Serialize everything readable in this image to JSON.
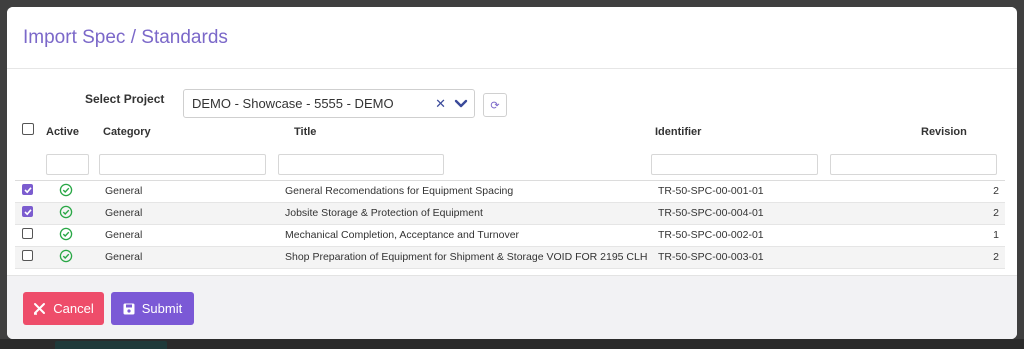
{
  "dialog": {
    "title": "Import Spec / Standards"
  },
  "project": {
    "label": "Select Project",
    "selected": "DEMO - Showcase - 5555 - DEMO",
    "clear_glyph": "✕",
    "refresh_glyph": "⟳"
  },
  "table": {
    "headers": {
      "active": "Active",
      "category": "Category",
      "title": "Title",
      "identifier": "Identifier",
      "revision": "Revision"
    },
    "rows": [
      {
        "checked": true,
        "active": true,
        "category": "General",
        "title": "General Recomendations for Equipment Spacing",
        "identifier": "TR-50-SPC-00-001-01",
        "revision": "2"
      },
      {
        "checked": true,
        "active": true,
        "category": "General",
        "title": "Jobsite Storage & Protection of Equipment",
        "identifier": "TR-50-SPC-00-004-01",
        "revision": "2"
      },
      {
        "checked": false,
        "active": true,
        "category": "General",
        "title": "Mechanical Completion, Acceptance and Turnover",
        "identifier": "TR-50-SPC-00-002-01",
        "revision": "1"
      },
      {
        "checked": false,
        "active": true,
        "category": "General",
        "title": "Shop Preparation of Equipment for Shipment & Storage VOID FOR 2195 CLH",
        "identifier": "TR-50-SPC-00-003-01",
        "revision": "2"
      }
    ]
  },
  "footer": {
    "cancel_label": "Cancel",
    "submit_label": "Submit"
  },
  "icons": {
    "active": "check-circle-icon",
    "cancel": "cancel-icon",
    "submit": "save-icon",
    "refresh": "refresh-icon",
    "chevron": "chevron-down-icon",
    "clear": "clear-icon"
  },
  "colors": {
    "accent": "#7b59d6",
    "title": "#7b68c9",
    "cancel": "#ee4d6a",
    "active_check": "#28a745",
    "select_icons": "#3a4a9a"
  }
}
